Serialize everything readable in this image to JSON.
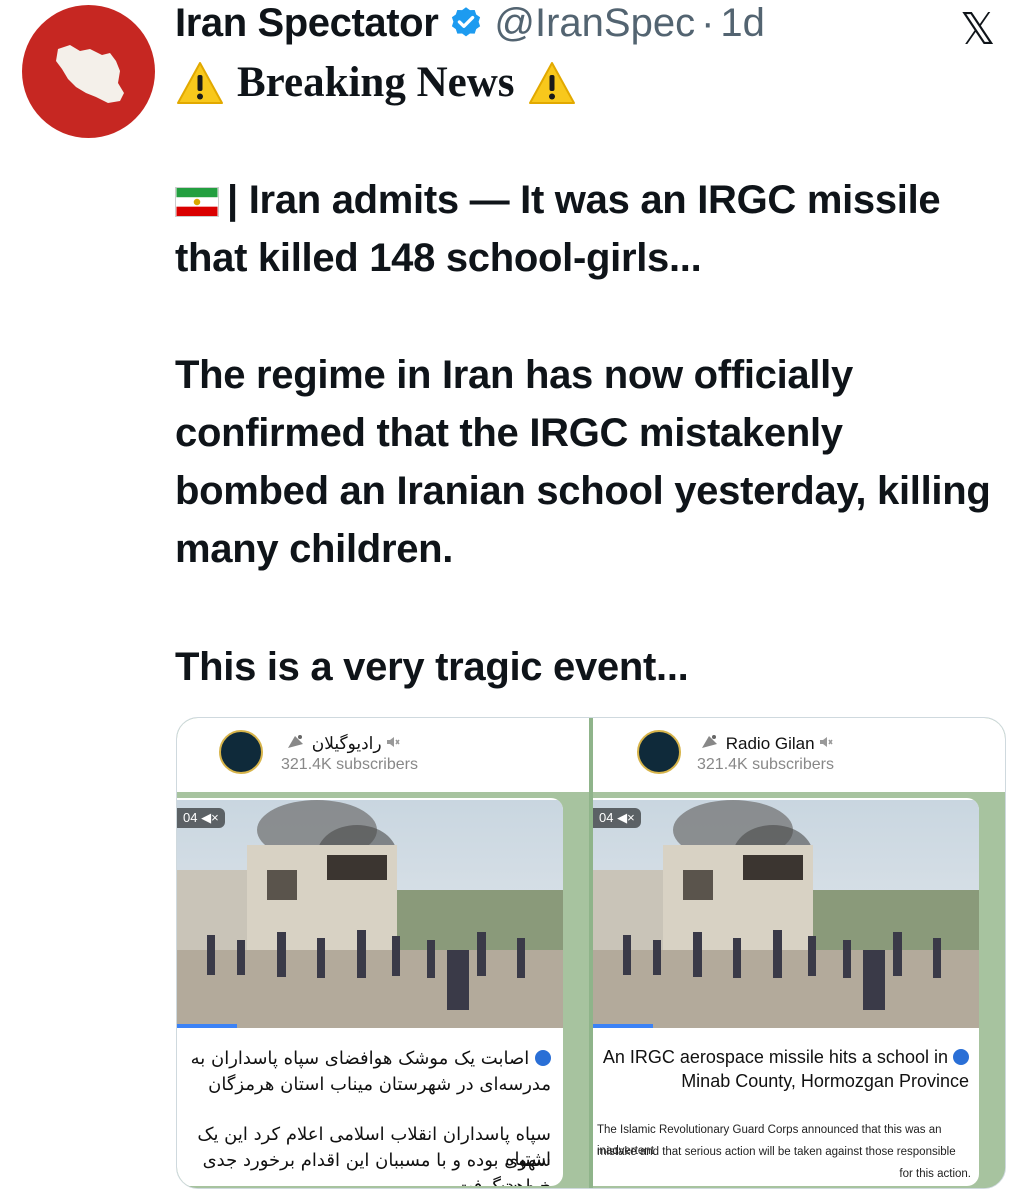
{
  "tweet": {
    "display_name": "Iran Spectator",
    "handle": "@IranSpec",
    "separator": "·",
    "time": "1d",
    "x_logo": "𝕏",
    "breaking": "Breaking News",
    "headline_flag_sep": "|",
    "headline": "Iran admits — It was an IRGC missile that killed 148 school-girls...",
    "paragraph_2": "The regime in Iran has now officially confirmed that the IRGC mistakenly bombed an Iranian school yesterday, killing many children.",
    "paragraph_3": "This is a very tragic event..."
  },
  "icons": {
    "avatar": "iran-map-icon",
    "verified": "verified-badge-icon",
    "warning": "warning-icon",
    "flag": "iran-flag-icon",
    "muted": "muted-speaker-icon",
    "satellite": "satellite-dish-icon"
  },
  "colors": {
    "avatar_bg": "#c62722",
    "verified_blue": "#1d9bf0",
    "secondary_text": "#536471",
    "telegram_bg": "#a7c39f"
  },
  "media": {
    "left": {
      "channel_name": "رادیوگیلان",
      "subscribers": "321.4K subscribers",
      "duration": "04",
      "caption_line1": "اصابت یک موشک هوافضای سپاه پاسداران به",
      "caption_line2": "مدرسه‌ای در شهرستان میناب استان هرمزگان",
      "body_line1": "سپاه پاسداران انقلاب اسلامی اعلام کرد این یک اشتباه",
      "body_line2": "سهوی بوده و با مسببان این اقدام برخورد جدی صورت",
      "body_line3": "خواهد گرفت."
    },
    "right": {
      "channel_name": "Radio Gilan",
      "subscribers": "321.4K subscribers",
      "duration": "04",
      "caption_line1": "An IRGC aerospace missile hits a school in",
      "caption_line2": "Minab County, Hormozgan Province",
      "body_line1": "The Islamic Revolutionary Guard Corps announced that this was an inadvertent",
      "body_line2": "mistake and that serious action will be taken against those responsible",
      "body_line3": "for this action."
    }
  }
}
